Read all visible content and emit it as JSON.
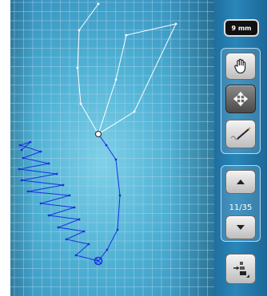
{
  "toolbar": {
    "stitch_width_label": "9 mm",
    "page_indicator": "11/35"
  },
  "icons": {
    "hand": "hand-icon",
    "move": "move-arrows-icon",
    "stitch_pen": "stitch-pen-icon",
    "up": "arrow-up-icon",
    "down": "arrow-down-icon",
    "insert": "insert-stitch-icon"
  },
  "colors": {
    "grid_line": "#a9d6ea",
    "stitch_blue": "#1a2fe0",
    "stitch_white": "#ffffff",
    "panel_bg": "#2a86b9"
  }
}
